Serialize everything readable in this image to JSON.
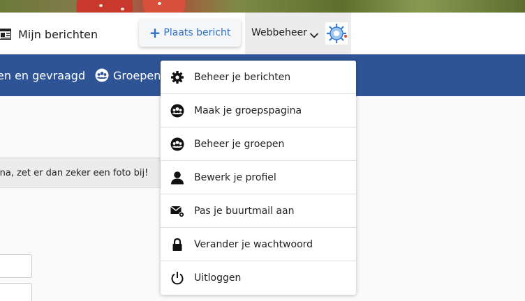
{
  "header": {
    "my_messages_label": "Mijn berichten",
    "place_message_label": "Plaats bericht",
    "account_name": "Webbeheer"
  },
  "nav": {
    "items": [
      {
        "label": "en en gevraagd"
      },
      {
        "label": "Groepen"
      }
    ]
  },
  "content": {
    "hint_text": "ina, zet er dan zeker een foto bij!"
  },
  "dropdown": {
    "items": [
      {
        "label": "Beheer je berichten",
        "icon": "gear-icon"
      },
      {
        "label": "Maak je groepspagina",
        "icon": "group-icon"
      },
      {
        "label": "Beheer je groepen",
        "icon": "group-icon"
      },
      {
        "label": "Bewerk je profiel",
        "icon": "person-icon"
      },
      {
        "label": "Pas je buurtmail aan",
        "icon": "mail-settings-icon"
      },
      {
        "label": "Verander je wachtwoord",
        "icon": "lock-icon"
      },
      {
        "label": "Uitloggen",
        "icon": "power-icon"
      }
    ]
  },
  "colors": {
    "nav_background": "#2f5495",
    "accent": "#2f6fc6"
  }
}
